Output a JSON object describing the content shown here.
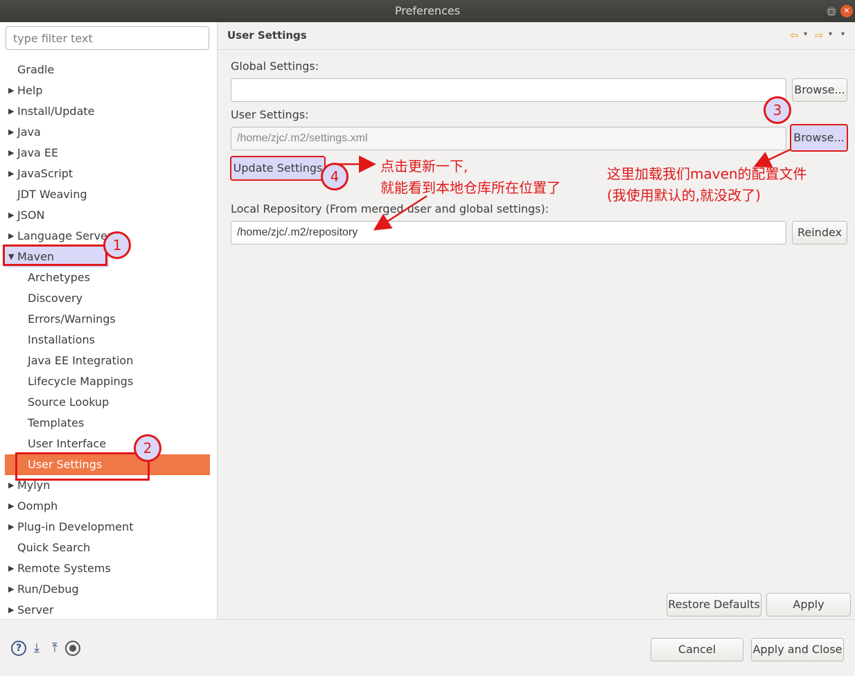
{
  "window": {
    "title": "Preferences",
    "maximize_glyph": "□",
    "close_glyph": "✕"
  },
  "filter": {
    "placeholder": "type filter text"
  },
  "tree": {
    "items": [
      {
        "label": "Gradle",
        "expandable": false
      },
      {
        "label": "Help",
        "expandable": true
      },
      {
        "label": "Install/Update",
        "expandable": true
      },
      {
        "label": "Java",
        "expandable": true
      },
      {
        "label": "Java EE",
        "expandable": true
      },
      {
        "label": "JavaScript",
        "expandable": true
      },
      {
        "label": "JDT Weaving",
        "expandable": false
      },
      {
        "label": "JSON",
        "expandable": true
      },
      {
        "label": "Language Servers",
        "expandable": true
      },
      {
        "label": "Maven",
        "expandable": true,
        "expanded": true
      },
      {
        "label": "Archetypes",
        "child": true
      },
      {
        "label": "Discovery",
        "child": true
      },
      {
        "label": "Errors/Warnings",
        "child": true
      },
      {
        "label": "Installations",
        "child": true
      },
      {
        "label": "Java EE Integration",
        "child": true
      },
      {
        "label": "Lifecycle Mappings",
        "child": true
      },
      {
        "label": "Source Lookup",
        "child": true
      },
      {
        "label": "Templates",
        "child": true
      },
      {
        "label": "User Interface",
        "child": true
      },
      {
        "label": "User Settings",
        "child": true,
        "selected": true
      },
      {
        "label": "Mylyn",
        "expandable": true
      },
      {
        "label": "Oomph",
        "expandable": true
      },
      {
        "label": "Plug-in Development",
        "expandable": true
      },
      {
        "label": "Quick Search",
        "expandable": false
      },
      {
        "label": "Remote Systems",
        "expandable": true
      },
      {
        "label": "Run/Debug",
        "expandable": true
      },
      {
        "label": "Server",
        "expandable": true
      }
    ]
  },
  "page": {
    "title": "User Settings",
    "nav": {
      "back_icon": "back-arrow-icon",
      "forward_icon": "forward-arrow-icon",
      "back_glyph": "⇦",
      "forward_glyph": "⇨",
      "dropdown_glyph": "▾"
    },
    "global_settings": {
      "label": "Global Settings:",
      "value": "",
      "browse": "Browse..."
    },
    "user_settings": {
      "label": "User Settings:",
      "value": "/home/zjc/.m2/settings.xml",
      "browse": "Browse..."
    },
    "update_button": "Update Settings",
    "local_repository": {
      "label": "Local Repository (From merged user and global settings):",
      "value": "/home/zjc/.m2/repository",
      "reindex": "Reindex"
    },
    "restore_defaults": "Restore Defaults",
    "apply": "Apply"
  },
  "footer": {
    "cancel": "Cancel",
    "apply_close": "Apply and Close",
    "icons": [
      "help-icon",
      "import-icon",
      "export-icon",
      "record-icon"
    ],
    "help_glyph": "?",
    "import_glyph": "⤓",
    "export_glyph": "⤒"
  },
  "annotations": {
    "markers": [
      "1",
      "2",
      "3",
      "4"
    ],
    "note_update_line1": "点击更新一下,",
    "note_update_line2": "就能看到本地仓库所在位置了",
    "note_browse_line1": "这里加载我们maven的配置文件",
    "note_browse_line2": "(我使用默认的,就没改了)",
    "color": "#e01818"
  },
  "colors": {
    "selection": "#f07746",
    "highlight": "#d9d8f8",
    "annotation": "#e01818"
  }
}
